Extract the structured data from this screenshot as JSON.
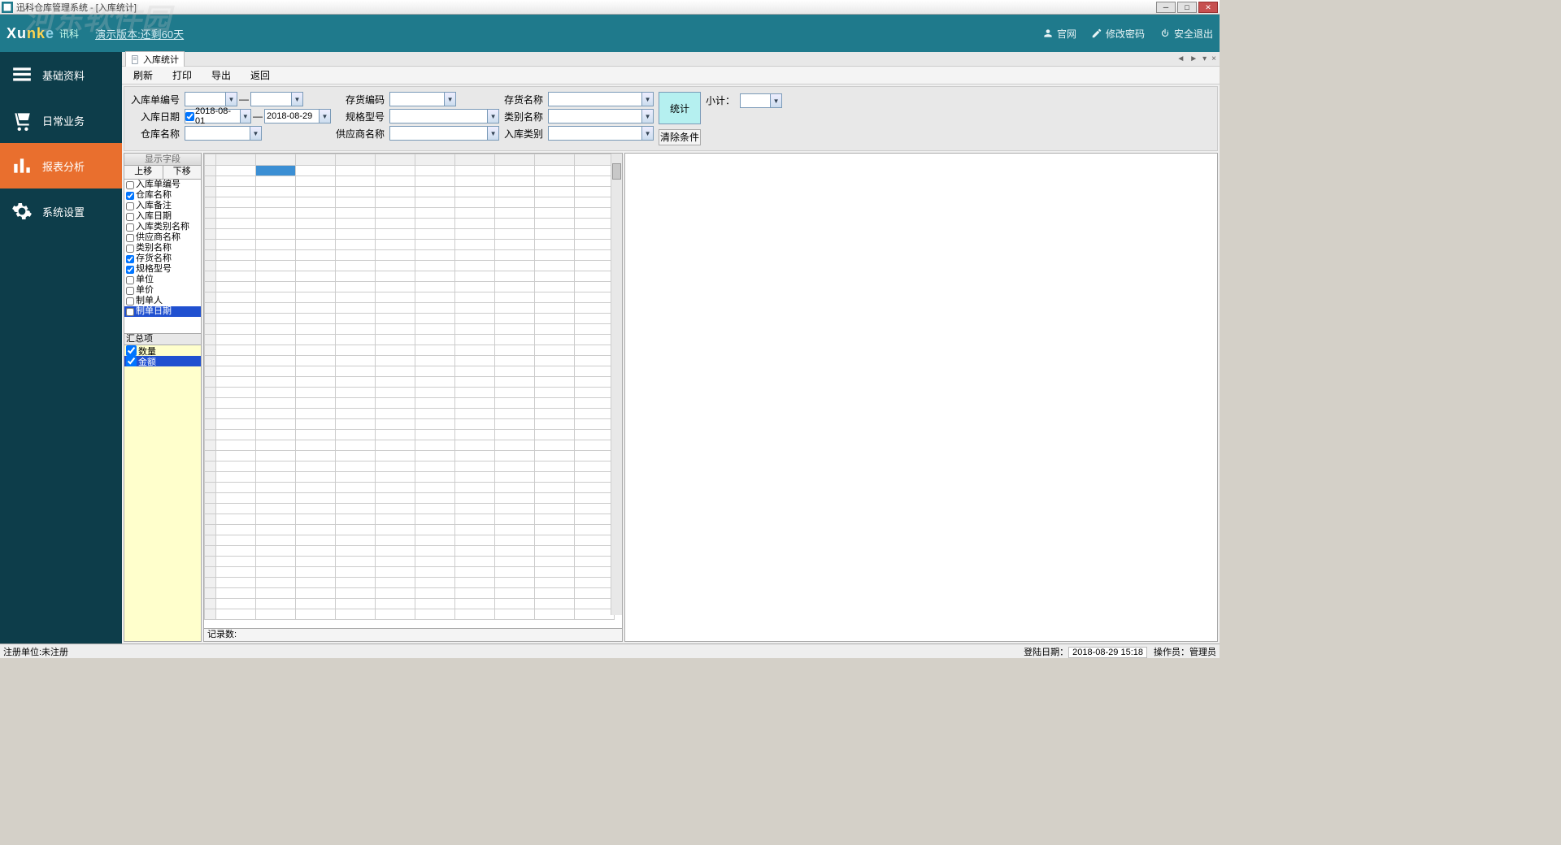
{
  "window": {
    "title": "迅科仓库管理系统 - [入库统计]"
  },
  "tealbar": {
    "brand": "讯科",
    "demo_text": "演示版本:还剩60天",
    "links": {
      "site": "官网",
      "pwd": "修改密码",
      "exit": "安全退出"
    }
  },
  "nav": {
    "items": [
      {
        "label": "基础资料"
      },
      {
        "label": "日常业务"
      },
      {
        "label": "报表分析"
      },
      {
        "label": "系统设置"
      }
    ]
  },
  "subtab": {
    "title": "入库统计"
  },
  "toolbar": {
    "refresh": "刷新",
    "print": "打印",
    "export": "导出",
    "back": "返回"
  },
  "filters": {
    "labels": {
      "order_no": "入库单编号",
      "in_date": "入库日期",
      "wh_name": "仓库名称",
      "stock_code": "存货编码",
      "spec": "规格型号",
      "supplier": "供应商名称",
      "stock_name": "存货名称",
      "cat_name": "类别名称",
      "in_type": "入库类别"
    },
    "date_from": "2018-08-01",
    "date_to": "2018-08-29",
    "btn_stat": "统计",
    "btn_clear": "清除条件",
    "subtotal_label": "小计："
  },
  "fields_panel": {
    "header": "显示字段",
    "up": "上移",
    "down": "下移",
    "items": [
      {
        "label": "入库单编号",
        "checked": false
      },
      {
        "label": "仓库名称",
        "checked": true
      },
      {
        "label": "入库备注",
        "checked": false
      },
      {
        "label": "入库日期",
        "checked": false
      },
      {
        "label": "入库类别名称",
        "checked": false
      },
      {
        "label": "供应商名称",
        "checked": false
      },
      {
        "label": "类别名称",
        "checked": false
      },
      {
        "label": "存货名称",
        "checked": true
      },
      {
        "label": "规格型号",
        "checked": true
      },
      {
        "label": "单位",
        "checked": false
      },
      {
        "label": "单价",
        "checked": false
      },
      {
        "label": "制单人",
        "checked": false
      },
      {
        "label": "制单日期",
        "checked": false,
        "selected": true
      }
    ],
    "sum_header": "汇总项",
    "sum_items": [
      {
        "label": "数量",
        "checked": true
      },
      {
        "label": "金额",
        "checked": true,
        "selected": true
      }
    ]
  },
  "grid": {
    "footer": "记录数:"
  },
  "statusbar": {
    "reg": "注册单位:未注册",
    "login_date_label": "登陆日期：",
    "login_date": "2018-08-29 15:18",
    "operator_label": "操作员：",
    "operator": "管理员"
  }
}
